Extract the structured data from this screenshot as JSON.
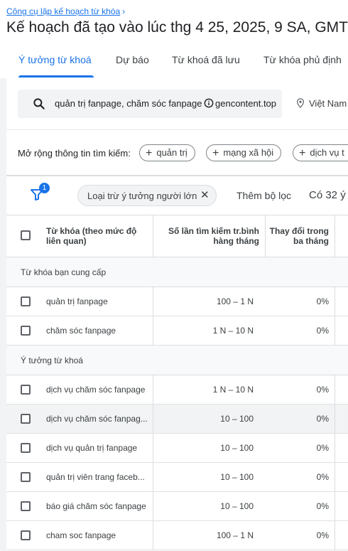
{
  "breadcrumb": {
    "label": "Công cụ lập kế hoạch từ khóa",
    "chevron": "›"
  },
  "title": "Kế hoạch đã tạo vào lúc thg 4 25, 2025, 9 SA, GMT",
  "tabs": [
    "Ý tưởng từ khoá",
    "Dự báo",
    "Từ khoá đã lưu",
    "Từ khóa phủ định"
  ],
  "search": {
    "keywords": "quản trị fanpage, chăm sóc fanpage",
    "domain": "gencontent.top"
  },
  "location": "Việt Nam",
  "expand": {
    "label": "Mở rộng thông tin tìm kiếm:",
    "chips": [
      "quản trị",
      "mạng xã hội",
      "dịch vụ t"
    ]
  },
  "filters": {
    "badge": "1",
    "chip_label": "Loại trừ ý tưởng người lớn",
    "close": "✕",
    "add_label": "Thêm bộ lọc",
    "count": "Có 32 ý"
  },
  "table": {
    "headers": {
      "keyword_1": "Từ khóa (theo mức độ",
      "keyword_2": "liên quan)",
      "volume_1": "Số lần tìm kiếm tr.bình",
      "volume_2": "hàng tháng",
      "change_1": "Thay đổi trong",
      "change_2": "ba tháng"
    },
    "sections": [
      {
        "title": "Từ khóa bạn cung cấp",
        "rows": [
          {
            "keyword": "quản trị fanpage",
            "volume": "100 – 1 N",
            "change": "0%"
          },
          {
            "keyword": "chăm sóc fanpage",
            "volume": "1 N – 10 N",
            "change": "0%"
          }
        ]
      },
      {
        "title": "Ý tưởng từ khoá",
        "rows": [
          {
            "keyword": "dịch vụ chăm sóc fanpage",
            "volume": "1 N – 10 N",
            "change": "0%"
          },
          {
            "keyword": "dịch vụ chăm sóc fanpag...",
            "volume": "10 – 100",
            "change": "0%"
          },
          {
            "keyword": "dịch vụ quản trị fanpage",
            "volume": "10 – 100",
            "change": "0%"
          },
          {
            "keyword": "quản trị viên trang faceb...",
            "volume": "10 – 100",
            "change": "0%"
          },
          {
            "keyword": "báo giá chăm sóc fanpage",
            "volume": "10 – 100",
            "change": "0%"
          },
          {
            "keyword": "cham soc fanpage",
            "volume": "100 – 1 N",
            "change": "0%"
          }
        ]
      }
    ]
  },
  "colors": {
    "accent": "#1a73e8",
    "panel": "#f1f3f4",
    "border": "#dadce0"
  }
}
